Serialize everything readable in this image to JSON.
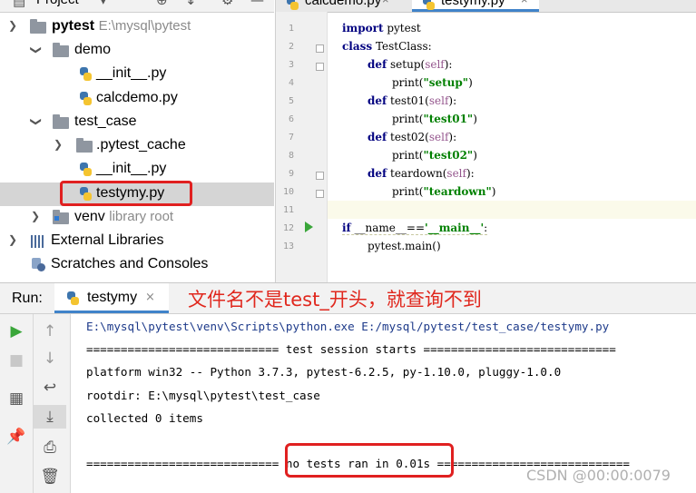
{
  "project": {
    "title": "Project",
    "root": {
      "name": "pytest",
      "path": "E:\\mysql\\pytest"
    },
    "tree": [
      {
        "label": "demo"
      },
      {
        "label": "__init__.py"
      },
      {
        "label": "calcdemo.py"
      },
      {
        "label": "test_case"
      },
      {
        "label": ".pytest_cache"
      },
      {
        "label": "__init__.py"
      },
      {
        "label": "testymy.py"
      },
      {
        "label": "venv",
        "note": "library root"
      },
      {
        "label": "External Libraries"
      },
      {
        "label": "Scratches and Consoles"
      }
    ]
  },
  "editor": {
    "tabs": [
      {
        "label": "calcdemo.py"
      },
      {
        "label": "testymy.py"
      }
    ],
    "line_numbers": [
      "1",
      "2",
      "3",
      "4",
      "5",
      "6",
      "7",
      "8",
      "9",
      "10",
      "11",
      "12",
      "13"
    ],
    "code": {
      "l1_kw": "import",
      "l1_rest": " pytest",
      "l2_kw": "class",
      "l2_rest": " TestClass:",
      "l3_kw": "def",
      "l3_fn": " setup(",
      "l3_self": "self",
      "l3_end": "):",
      "l4_fn": "print(",
      "l4_str": "\"setup\"",
      "l4_end": ")",
      "l5_kw": "def",
      "l5_fn": " test01(",
      "l5_self": "self",
      "l5_end": "):",
      "l6_fn": "print(",
      "l6_str": "\"test01\"",
      "l6_end": ")",
      "l7_kw": "def",
      "l7_fn": " test02(",
      "l7_self": "self",
      "l7_end": "):",
      "l8_fn": "print(",
      "l8_str": "\"test02\"",
      "l8_end": ")",
      "l9_kw": "def",
      "l9_fn": " teardown(",
      "l9_self": "self",
      "l9_end": "):",
      "l10_fn": "print(",
      "l10_str": "\"teardown\"",
      "l10_end": ")",
      "l12_kw": "if",
      "l12_mid": " __name__==",
      "l12_str": "'__main__'",
      "l12_end": ":",
      "l13_text": "pytest.main()"
    }
  },
  "run": {
    "label": "Run:",
    "tab_label": "testymy",
    "annotation": "文件名不是test_开头，就查询不到",
    "console": [
      "E:\\mysql\\pytest\\venv\\Scripts\\python.exe E:/mysql/pytest/test_case/testymy.py",
      "============================ test session starts ============================",
      "platform win32 -- Python 3.7.3, pytest-6.2.5, py-1.10.0, pluggy-1.0.0",
      "rootdir: E:\\mysql\\pytest\\test_case",
      "collected 0 items",
      "",
      "============================ no tests ran in 0.01s ============================"
    ]
  },
  "watermark": "CSDN @00:00:0079",
  "colors": {
    "accent": "#4083c9",
    "annotation": "#e0281e",
    "keyword": "#000080",
    "string": "#008000"
  }
}
